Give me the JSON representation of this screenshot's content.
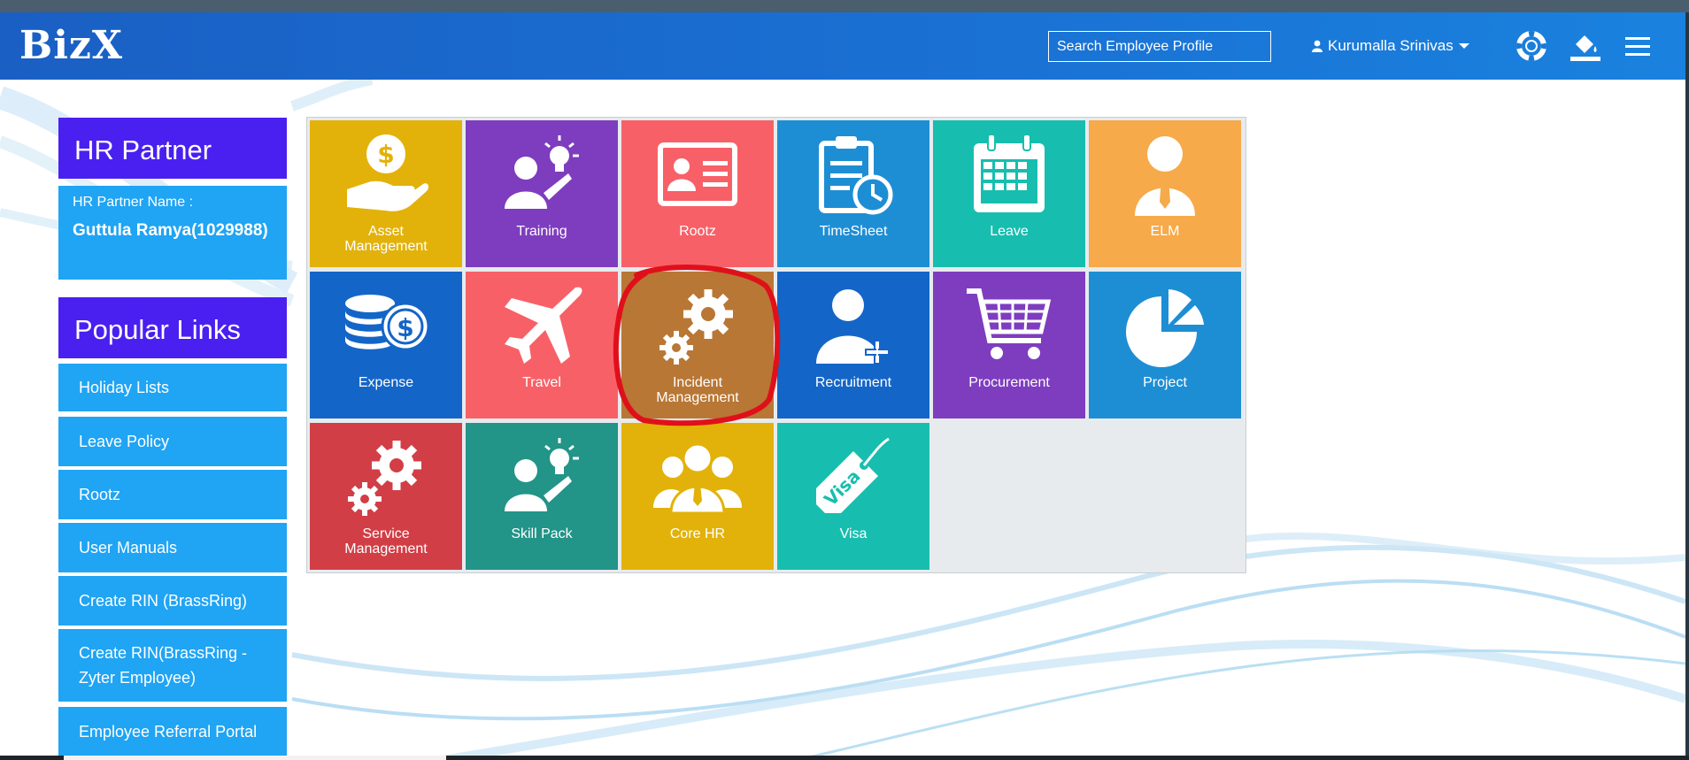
{
  "header": {
    "logo": "BizX",
    "search_placeholder": "Search Employee Profile",
    "user_name": "Kurumalla Srinivas",
    "icons": [
      "lifebuoy-icon",
      "paint-bucket-icon",
      "hamburger-menu-icon"
    ]
  },
  "sidebar": {
    "hr_partner": {
      "title": "HR Partner",
      "name_label": "HR Partner Name :",
      "name_value": "Guttula Ramya(1029988)"
    },
    "popular_links": {
      "title": "Popular Links",
      "items": [
        {
          "label": "Holiday Lists"
        },
        {
          "label": "Leave Policy"
        },
        {
          "label": "Rootz"
        },
        {
          "label": "User Manuals"
        },
        {
          "label": "Create RIN (BrassRing)"
        },
        {
          "label": "Create RIN(BrassRing - Zyter Employee)"
        },
        {
          "label": "Employee Referral Portal"
        }
      ]
    }
  },
  "tiles": [
    {
      "label": "Asset Management",
      "color": "#E2B20A",
      "icon": "hand-dollar-icon"
    },
    {
      "label": "Training",
      "color": "#7E3DBF",
      "icon": "trainer-bulb-icon"
    },
    {
      "label": "Rootz",
      "color": "#F86067",
      "icon": "id-card-icon"
    },
    {
      "label": "TimeSheet",
      "color": "#1E8ED4",
      "icon": "clipboard-clock-icon"
    },
    {
      "label": "Leave",
      "color": "#17BEAF",
      "icon": "calendar-icon"
    },
    {
      "label": "ELM",
      "color": "#F6AA49",
      "icon": "person-tie-icon"
    },
    {
      "label": "Expense",
      "color": "#1465C8",
      "icon": "coins-dollar-icon"
    },
    {
      "label": "Travel",
      "color": "#F86067",
      "icon": "airplane-icon"
    },
    {
      "label": "Incident Management",
      "color": "#B87735",
      "icon": "gears-icon",
      "highlighted": true,
      "highlight_color": "#E0101A"
    },
    {
      "label": "Recruitment",
      "color": "#1465C8",
      "icon": "add-user-icon"
    },
    {
      "label": "Procurement",
      "color": "#7E3DBF",
      "icon": "shopping-cart-icon"
    },
    {
      "label": "Project",
      "color": "#1E8ED4",
      "icon": "pie-chart-icon"
    },
    {
      "label": "Service Management",
      "color": "#D23E46",
      "icon": "gears-icon"
    },
    {
      "label": "Skill Pack",
      "color": "#229488",
      "icon": "trainer-bulb-icon"
    },
    {
      "label": "Core HR",
      "color": "#E2B20A",
      "icon": "group-icon"
    },
    {
      "label": "Visa",
      "color": "#17BEAF",
      "icon": "visa-tag-icon"
    }
  ]
}
